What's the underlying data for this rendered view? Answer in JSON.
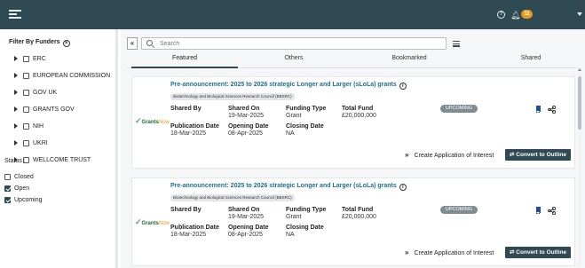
{
  "topbar": {
    "menu_icon": "hamburger-icon",
    "help_icon": "question-circle-icon",
    "help_glyph": "?",
    "notification_icon": "bell-icon",
    "notification_count": "11",
    "user_menu_icon": "caret-down-icon"
  },
  "sidebar": {
    "title": "Filter By Funders",
    "funders": [
      {
        "label": "ERC",
        "checked": false
      },
      {
        "label": "EUROPEAN COMMISSION",
        "checked": false
      },
      {
        "label": "GOV UK",
        "checked": false
      },
      {
        "label": "GRANTS GOV",
        "checked": false
      },
      {
        "label": "NIH",
        "checked": false
      },
      {
        "label": "UKRI",
        "checked": false
      },
      {
        "label": "WELLCOME TRUST",
        "checked": false
      }
    ],
    "status_title": "Status :",
    "statuses": [
      {
        "label": "Closed",
        "checked": false
      },
      {
        "label": "Open",
        "checked": true
      },
      {
        "label": "Upcoming",
        "checked": true
      }
    ]
  },
  "search": {
    "collapse_glyph": "«",
    "placeholder": "Search",
    "value": ""
  },
  "tabs": [
    {
      "label": "Featured",
      "active": true
    },
    {
      "label": "Others",
      "active": false
    },
    {
      "label": "Bookmarked",
      "active": false
    },
    {
      "label": "Shared",
      "active": false
    }
  ],
  "cards": [
    {
      "title": "Pre-announcement: 2025 to 2026 strategic Longer and Larger (sLoLa) grants",
      "council": "Biotechnology and Biological Sciences Research Council (BBSRC)",
      "logo_main": "Grants",
      "logo_accent": "Now",
      "shared_by_label": "Shared By",
      "shared_by_value": "",
      "shared_on_label": "Shared On",
      "shared_on_value": "19-Mar-2025",
      "funding_type_label": "Funding Type",
      "funding_type_value": "Grant",
      "total_fund_label": "Total Fund",
      "total_fund_value": "£20,000,000",
      "publication_label": "Publication Date",
      "publication_value": "18-Mar-2025",
      "opening_label": "Opening Date",
      "opening_value": "08-Apr-2025",
      "closing_label": "Closing Date",
      "closing_value": "NA",
      "status": "UPCOMING",
      "interest_button": "Create Application of Interest",
      "outline_button": "Convert to Outline"
    },
    {
      "title": "Pre-announcement: 2025 to 2026 strategic Longer and Larger (sLoLa) grants",
      "council": "Biotechnology and Biological Sciences Research Council (BBSRC)",
      "logo_main": "Grants",
      "logo_accent": "Now",
      "shared_by_label": "Shared By",
      "shared_by_value": "",
      "shared_on_label": "Shared On",
      "shared_on_value": "19-Mar-2025",
      "funding_type_label": "Funding Type",
      "funding_type_value": "Grant",
      "total_fund_label": "Total Fund",
      "total_fund_value": "£20,000,000",
      "publication_label": "Publication Date",
      "publication_value": "18-Mar-2025",
      "opening_label": "Opening Date",
      "opening_value": "08-Apr-2025",
      "closing_label": "Closing Date",
      "closing_value": "NA",
      "status": "UPCOMING",
      "interest_button": "Create Application of Interest",
      "outline_button": "Convert to Outline"
    }
  ]
}
